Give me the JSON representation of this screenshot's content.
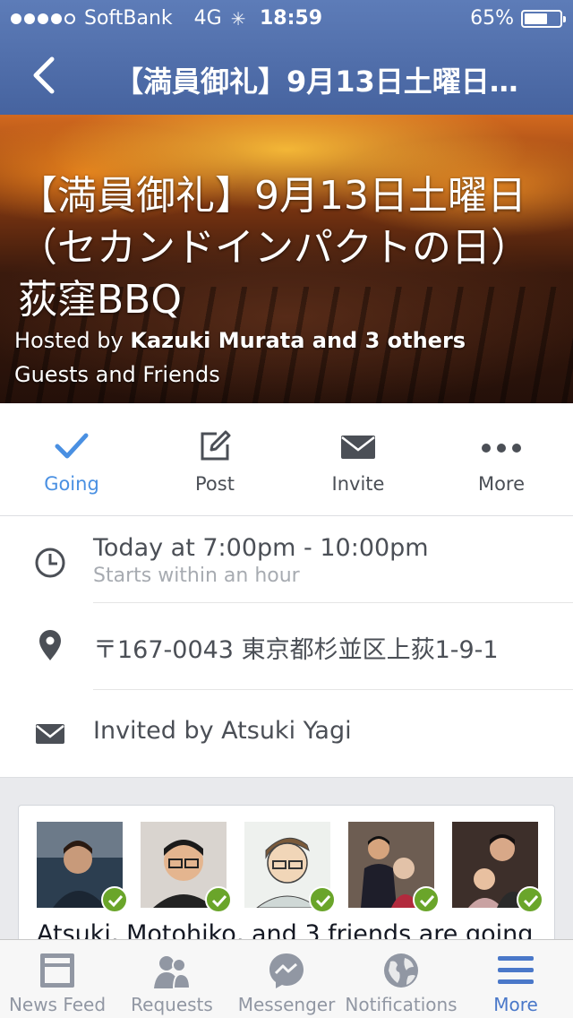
{
  "status_bar": {
    "carrier": "SoftBank",
    "network": "4G",
    "time": "18:59",
    "battery": "65%",
    "battery_level": 0.65
  },
  "nav": {
    "back_icon": "chevron-left-icon",
    "title": "【満員御礼】9月13日土曜日…"
  },
  "cover": {
    "title": "【満員御礼】9月13日土曜日（セカンドインパクトの日）荻窪BBQ",
    "hosted_prefix": "Hosted by ",
    "hosted_names": "Kazuki Murata and 3 others",
    "audience": "Guests and Friends"
  },
  "actions": [
    {
      "label": "Going",
      "icon": "checkmark-icon",
      "active": true
    },
    {
      "label": "Post",
      "icon": "edit-icon",
      "active": false
    },
    {
      "label": "Invite",
      "icon": "envelope-icon",
      "active": false
    },
    {
      "label": "More",
      "icon": "more-dots-icon",
      "active": false
    }
  ],
  "details": {
    "time": "Today at 7:00pm - 10:00pm",
    "time_sub": "Starts within an hour",
    "location": "〒167-0043 東京都杉並区上荻1-9-1",
    "invited_by": "Invited by Atsuki  Yagi"
  },
  "friends": {
    "summary": "Atsuki, Motohiko, and 3 friends are going"
  },
  "tabs": [
    {
      "label": "News Feed",
      "icon": "news-feed-icon"
    },
    {
      "label": "Requests",
      "icon": "friend-requests-icon"
    },
    {
      "label": "Messenger",
      "icon": "messenger-icon"
    },
    {
      "label": "Notifications",
      "icon": "globe-icon"
    },
    {
      "label": "More",
      "icon": "menu-icon"
    }
  ],
  "colors": {
    "nav_blue": "#4e6daa",
    "accent_blue": "#4a90e2",
    "going_check_green": "#6aa52a"
  }
}
